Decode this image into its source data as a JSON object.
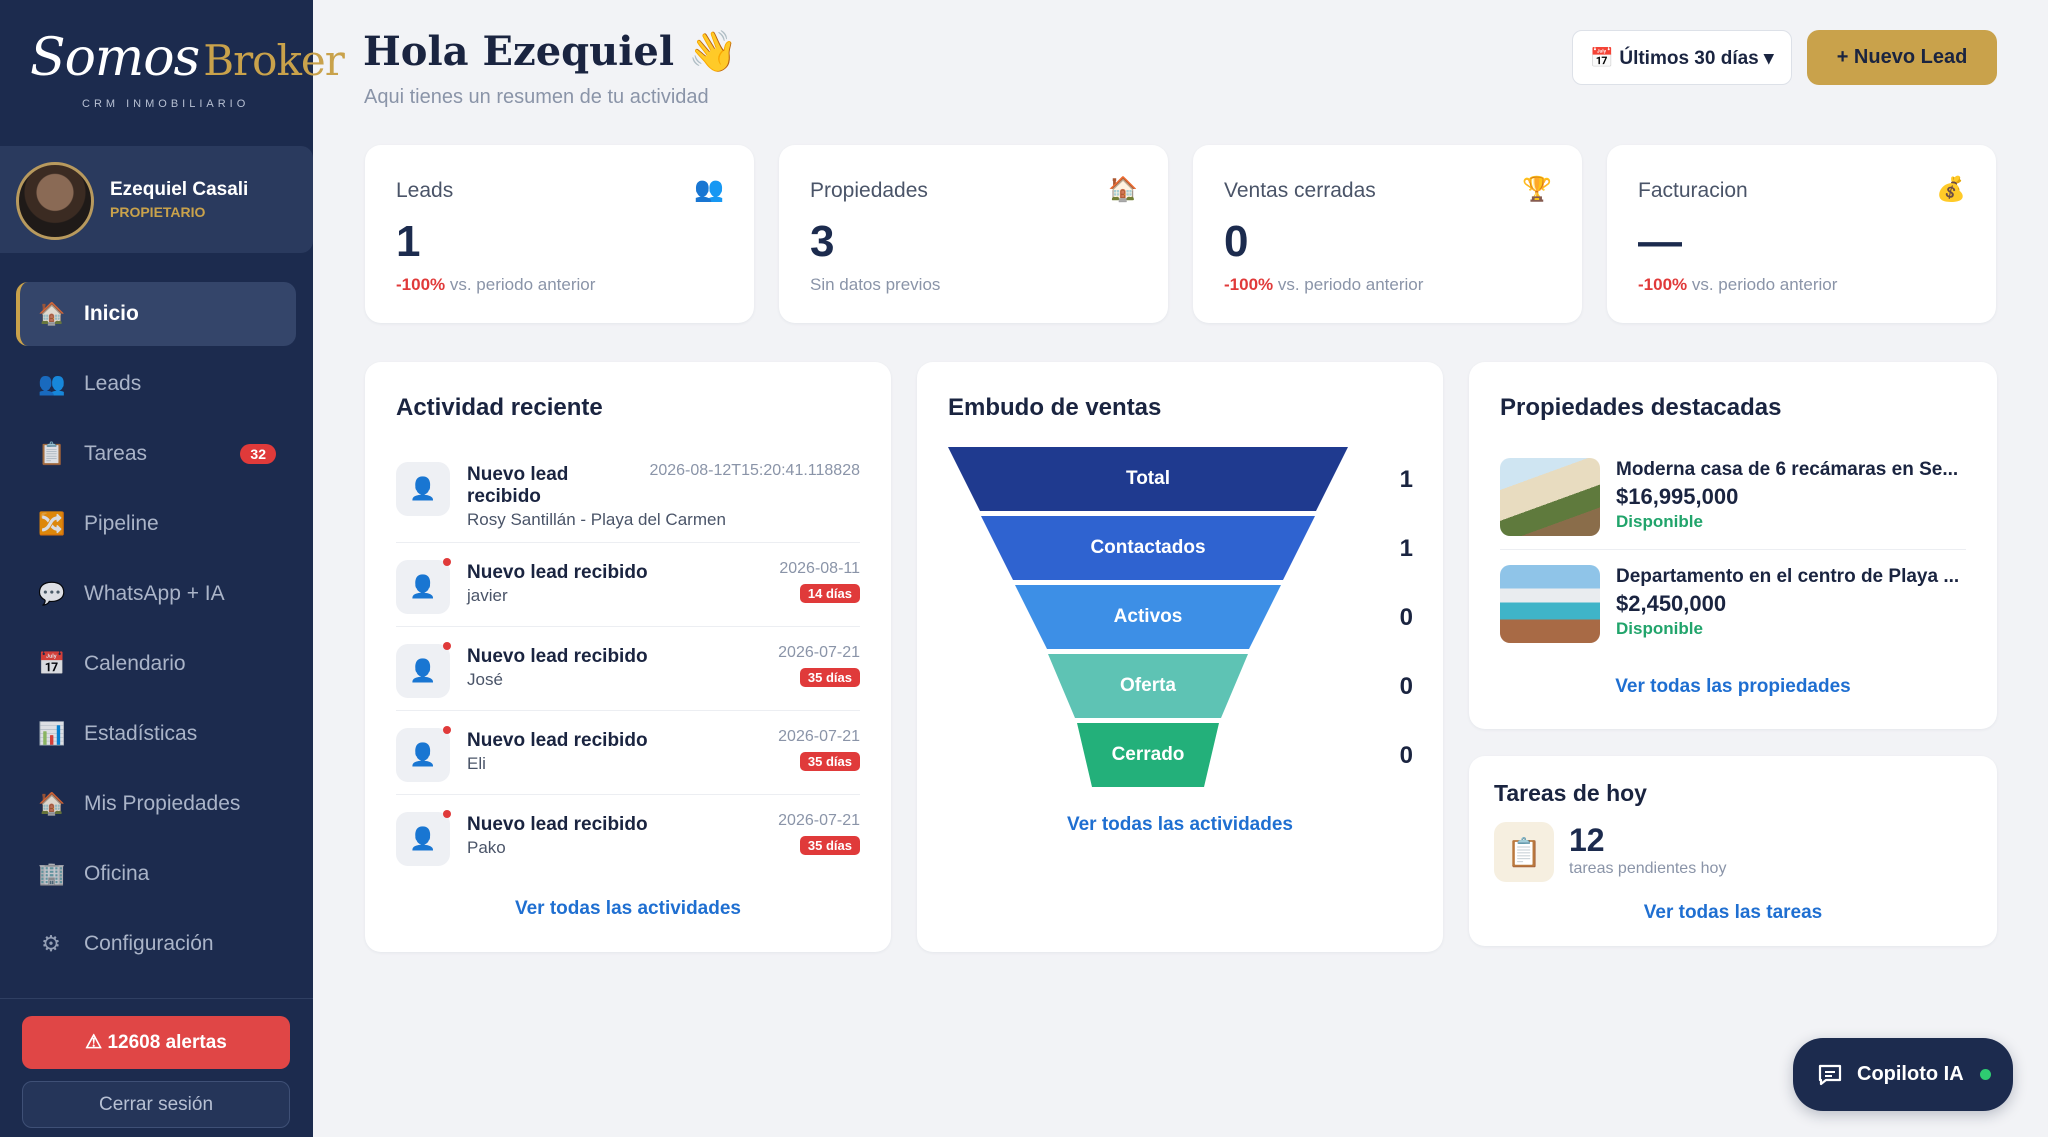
{
  "brand": {
    "logo_script": "Somos",
    "logo_broker": "Broker",
    "logo_sub": "CRM INMOBILIARIO",
    "accent": "#c9a24b",
    "sidebar_bg": "#1c2b4e"
  },
  "user": {
    "name": "Ezequiel Casali",
    "role": "PROPIETARIO"
  },
  "nav": [
    {
      "label": "Inicio",
      "icon": "house-icon",
      "active": true
    },
    {
      "label": "Leads",
      "icon": "users-icon"
    },
    {
      "label": "Tareas",
      "icon": "clipboard-icon",
      "badge": "32"
    },
    {
      "label": "Pipeline",
      "icon": "shuffle-icon"
    },
    {
      "label": "WhatsApp + IA",
      "icon": "chat-icon"
    },
    {
      "label": "Calendario",
      "icon": "calendar-icon"
    },
    {
      "label": "Estadísticas",
      "icon": "bar-chart-icon"
    },
    {
      "label": "Mis Propiedades",
      "icon": "house-icon"
    },
    {
      "label": "Oficina",
      "icon": "office-icon"
    },
    {
      "label": "Configuración",
      "icon": "gear-icon"
    }
  ],
  "sidebar_footer": {
    "alerts": "⚠ 12608 alertas",
    "logout": "Cerrar sesión"
  },
  "header": {
    "greeting": "Hola Ezequiel 👋",
    "subtitle": "Aqui tienes un resumen de tu actividad",
    "period": "📅 Últimos 30 días ▾",
    "new_lead": "+ Nuevo Lead"
  },
  "kpis": [
    {
      "label": "Leads",
      "icon": "👥",
      "value": "1",
      "delta": "-100%",
      "note": " vs. periodo anterior"
    },
    {
      "label": "Propiedades",
      "icon": "🏠",
      "value": "3",
      "delta": "",
      "note": "Sin datos previos"
    },
    {
      "label": "Ventas cerradas",
      "icon": "🏆",
      "value": "0",
      "delta": "-100%",
      "note": " vs. periodo anterior"
    },
    {
      "label": "Facturacion",
      "icon": "💰",
      "value": "—",
      "delta": "-100%",
      "note": " vs. periodo anterior"
    }
  ],
  "activity": {
    "title": "Actividad reciente",
    "items": [
      {
        "title": "Nuevo lead recibido",
        "sub": "Rosy Santillán - Playa del Carmen",
        "date": "2026-08-12T15:20:41.118828",
        "age": ""
      },
      {
        "title": "Nuevo lead recibido",
        "sub": "javier",
        "date": "2026-08-11",
        "age": "14 días"
      },
      {
        "title": "Nuevo lead recibido",
        "sub": "José",
        "date": "2026-07-21",
        "age": "35 días"
      },
      {
        "title": "Nuevo lead recibido",
        "sub": "Eli",
        "date": "2026-07-21",
        "age": "35 días"
      },
      {
        "title": "Nuevo lead recibido",
        "sub": "Pako",
        "date": "2026-07-21",
        "age": "35 días"
      }
    ],
    "link": "Ver todas las actividades"
  },
  "funnel": {
    "title": "Embudo de ventas",
    "stages": [
      {
        "label": "Total",
        "count": "1",
        "color": "#1f3a8f"
      },
      {
        "label": "Contactados",
        "count": "1",
        "color": "#2f63d0"
      },
      {
        "label": "Activos",
        "count": "0",
        "color": "#3d8fe6"
      },
      {
        "label": "Oferta",
        "count": "0",
        "color": "#5ec3b4"
      },
      {
        "label": "Cerrado",
        "count": "0",
        "color": "#23b07a"
      }
    ],
    "link": "Ver todas las actividades"
  },
  "properties": {
    "title": "Propiedades destacadas",
    "items": [
      {
        "title": "Moderna casa de 6 recámaras en Se...",
        "price": "$16,995,000",
        "status": "Disponible"
      },
      {
        "title": "Departamento en el centro de Playa ...",
        "price": "$2,450,000",
        "status": "Disponible"
      }
    ],
    "link": "Ver todas las propiedades"
  },
  "tasks": {
    "title": "Tareas de hoy",
    "icon": "📋",
    "count": "12",
    "sub": "tareas pendientes hoy",
    "link": "Ver todas las tareas"
  },
  "copilot": {
    "label": "Copiloto IA"
  }
}
